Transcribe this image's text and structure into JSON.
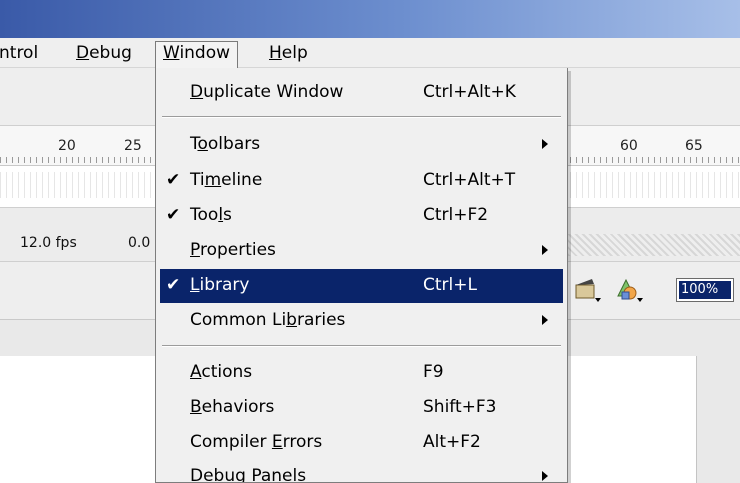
{
  "menubar": {
    "items": [
      {
        "pre": "",
        "u": "",
        "post": "ntrol"
      },
      {
        "pre": "",
        "u": "D",
        "post": "ebug"
      },
      {
        "pre": "",
        "u": "W",
        "post": "indow"
      },
      {
        "pre": "",
        "u": "H",
        "post": "elp"
      }
    ]
  },
  "ruler": {
    "numbers": [
      "20",
      "25",
      "60",
      "65"
    ]
  },
  "timeline_info": {
    "fps": "12.0 fps",
    "time": "0.0"
  },
  "zoom": {
    "value": "100%"
  },
  "window_menu": {
    "items": [
      {
        "check": "",
        "pre": "",
        "u": "D",
        "post": "uplicate Window",
        "shortcut": "Ctrl+Alt+K"
      },
      {
        "check": "",
        "pre": "T",
        "u": "o",
        "post": "olbars",
        "shortcut": ""
      },
      {
        "check": "✔",
        "pre": "Ti",
        "u": "m",
        "post": "eline",
        "shortcut": "Ctrl+Alt+T"
      },
      {
        "check": "✔",
        "pre": "Too",
        "u": "l",
        "post": "s",
        "shortcut": "Ctrl+F2"
      },
      {
        "check": "",
        "pre": "",
        "u": "P",
        "post": "roperties",
        "shortcut": ""
      },
      {
        "check": "✔",
        "pre": "",
        "u": "L",
        "post": "ibrary",
        "shortcut": "Ctrl+L"
      },
      {
        "check": "",
        "pre": "Common Li",
        "u": "b",
        "post": "raries",
        "shortcut": ""
      },
      {
        "check": "",
        "pre": "",
        "u": "A",
        "post": "ctions",
        "shortcut": "F9"
      },
      {
        "check": "",
        "pre": "",
        "u": "B",
        "post": "ehaviors",
        "shortcut": "Shift+F3"
      },
      {
        "check": "",
        "pre": "Compiler ",
        "u": "E",
        "post": "rrors",
        "shortcut": "Alt+F2"
      },
      {
        "check": "",
        "pre": "Debu",
        "u": "g",
        "post": " Panels",
        "shortcut": ""
      }
    ]
  }
}
